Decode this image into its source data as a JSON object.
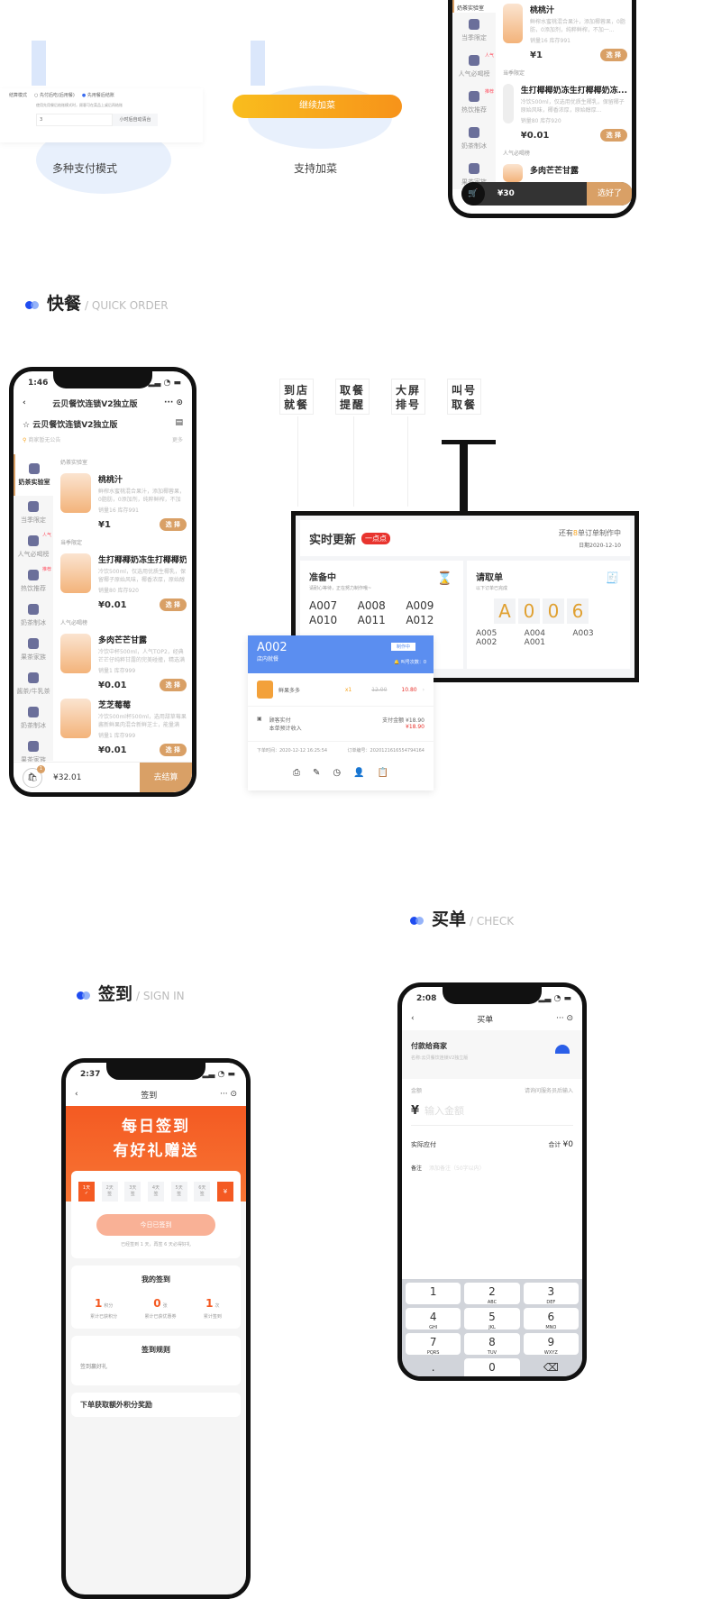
{
  "top": {
    "pay_mode": {
      "label": "结算模式",
      "option1": "先付后吃(后用餐)",
      "option2": "先用餐后结账",
      "hint": "使用先用餐后结账模式时，顾客可在菜品上桌后再结账",
      "input_value": "3",
      "input_suffix": "小时后自动清台",
      "caption": "多种支付模式"
    },
    "add_dish": {
      "button": "继续加菜",
      "caption": "支持加菜"
    },
    "phone": {
      "categories": [
        "奶茶实验室",
        "当季限定",
        "人气必喝榜",
        "热饮推荐",
        "奶茶制冰",
        "果茶家族",
        "奶茶制冰"
      ],
      "badge_hot": "人气",
      "badge_new": "推荐",
      "groups": [
        "当季限定",
        "人气必喝榜"
      ],
      "items": [
        {
          "name": "桃桃汁",
          "desc": "鲜榨水蜜桃混合果汁，添加椰蓉果，0脂肪，0添加剂，纯粹鲜榨，不加一...",
          "stock": "销量16  库存991",
          "price": "¥1"
        },
        {
          "name": "生打椰椰奶冻生打椰椰奶冻...",
          "desc": "冷饮500ml，仅选用优质生椰乳，保留椰子原始风味，椰香浓厚，原始醇厚...",
          "stock": "销量80  库存920",
          "price": "¥0.01"
        },
        {
          "name": "多肉芒芒甘露",
          "desc": "",
          "stock": "",
          "price": ""
        }
      ],
      "select": "选 择",
      "cart_total": "¥30",
      "cart_count": "1",
      "checkout": "选好了"
    }
  },
  "quick": {
    "title_cn": "快餐",
    "title_en": "/ QUICK ORDER",
    "phone": {
      "time": "1:46",
      "nav_title": "云贝餐饮连锁V2独立版",
      "shop": "云贝餐饮连锁V2独立版",
      "notice": "商家暂无公告",
      "more": "更多",
      "categories": [
        "奶茶实验室",
        "当季限定",
        "人气必喝榜",
        "热饮推荐",
        "奶茶制冰",
        "果茶家族",
        "酱茶/牛乳茶",
        "奶茶制冰",
        "果茶家族"
      ],
      "badge_hot": "人气",
      "badge_new": "推荐",
      "items": [
        {
          "group": "奶茶实验室",
          "name": "桃桃汁",
          "desc": "鲜榨水蜜桃混合果汁，添加椰蓉果，0脂肪，0添加剂，纯粹鲜榨，不加一...",
          "stock": "销量16  库存991",
          "price": "¥1"
        },
        {
          "group": "当季限定",
          "name": "生打椰椰奶冻生打椰椰奶冻...",
          "desc": "冷饮500ml，仅选用优质生椰乳，保留椰子原始风味，椰香浓厚，原始醇厚...",
          "stock": "销量80  库存920",
          "price": "¥0.01"
        },
        {
          "group": "人气必喝榜",
          "name": "多肉芒芒甘露",
          "desc": "冷饮中杯500ml，人气TOP2，经典芒芒仔纯粹甘露的完美碰撞，精选满椰...",
          "stock": "销量1  库存999",
          "price": "¥0.01"
        },
        {
          "group": "",
          "name": "芝芝莓莓",
          "desc": "冷饮500ml杯500ml，选用甜草莓果酱新鲜果肉混合新鲜芝士，能量满满...",
          "stock": "销量1  库存999",
          "price": "¥0.01"
        }
      ],
      "select": "选 择",
      "cart_badge": "1",
      "cart_total": "¥32.01",
      "checkout": "去结算"
    },
    "tags": [
      "到店就餐",
      "取餐提醒",
      "大屏排号",
      "叫号取餐"
    ],
    "screen": {
      "title": "实时更新",
      "badge": "一点点",
      "remaining_pre": "还有",
      "remaining_num": "8",
      "remaining_post": "单订单制作中",
      "date": "日期2020-12-10",
      "preparing": {
        "title": "准备中",
        "sub": "请耐心等待，正在努力制作哦~",
        "orders": [
          "A007",
          "A008",
          "A009",
          "A010",
          "A011",
          "A012"
        ]
      },
      "pickup": {
        "title": "请取单",
        "sub": "以下订单已完成",
        "current": [
          "A",
          "0",
          "0",
          "6"
        ],
        "orders": [
          "A005",
          "A004",
          "A003",
          "A002",
          "A001"
        ]
      }
    },
    "order_card": {
      "number": "A002",
      "type": "店内就餐",
      "status": "制作中",
      "call_count": "叫号次数：0",
      "item_name": "鲜果多多",
      "qty": "x1",
      "orig_price": "12.00",
      "price": "10.80",
      "pay_label1": "顾客实付",
      "pay_label2": "本单预计收入",
      "pay_total_label": "支付金额",
      "pay_total": "¥18.90",
      "income": "¥18.90",
      "order_time": "下单时间：2020-12-12 16:25:54",
      "order_no": "订单编号：2020121616554794164"
    }
  },
  "signin": {
    "title_cn": "签到",
    "title_en": "/ SIGN IN",
    "phone": {
      "time": "2:37",
      "nav_title": "签到",
      "banner1": "每日签到",
      "banner2": "有好礼赠送",
      "days": [
        "1天",
        "2天",
        "3天",
        "4天",
        "5天",
        "6天"
      ],
      "day_sub": "签",
      "button": "今日已签到",
      "hint": "已经签到 1 天，再签 6 天必得好礼",
      "mine_title": "我的签到",
      "stats": [
        {
          "value": "1",
          "unit": "积分",
          "label": "累计已获积分"
        },
        {
          "value": "0",
          "unit": "张",
          "label": "累计已获优惠券"
        },
        {
          "value": "1",
          "unit": "次",
          "label": "累计签到"
        }
      ],
      "rules_title": "签到规则",
      "rules_text": "签到赢好礼",
      "extra": "下单获取额外积分奖励"
    }
  },
  "check": {
    "title_cn": "买单",
    "title_en": "/ CHECK",
    "phone": {
      "time": "2:08",
      "nav_title": "买单",
      "pay_to": "付款给商家",
      "merchant": "名称:云贝餐饮连锁V2独立版",
      "amount_label": "金额",
      "amount_hint": "请询问服务员后输入",
      "currency": "¥",
      "amount_placeholder": "输入金额",
      "actual_label": "实际应付",
      "total_label": "合计",
      "total": "¥0",
      "remark_label": "备注",
      "remark_placeholder": "添加备注（50字以内）",
      "keys": [
        {
          "n": "1",
          "l": ""
        },
        {
          "n": "2",
          "l": "ABC"
        },
        {
          "n": "3",
          "l": "DEF"
        },
        {
          "n": "4",
          "l": "GHI"
        },
        {
          "n": "5",
          "l": "JKL"
        },
        {
          "n": "6",
          "l": "MNO"
        },
        {
          "n": "7",
          "l": "PQRS"
        },
        {
          "n": "8",
          "l": "TUV"
        },
        {
          "n": "9",
          "l": "WXYZ"
        },
        {
          "n": ".",
          "l": ""
        },
        {
          "n": "0",
          "l": ""
        }
      ]
    }
  },
  "colors": {
    "accent_blue": "#1f4cf0",
    "orange": "#f7a21b",
    "gold": "#d9a066",
    "signin_orange": "#f45a22",
    "card_blue": "#5b8ef0",
    "red": "#e8342e"
  }
}
